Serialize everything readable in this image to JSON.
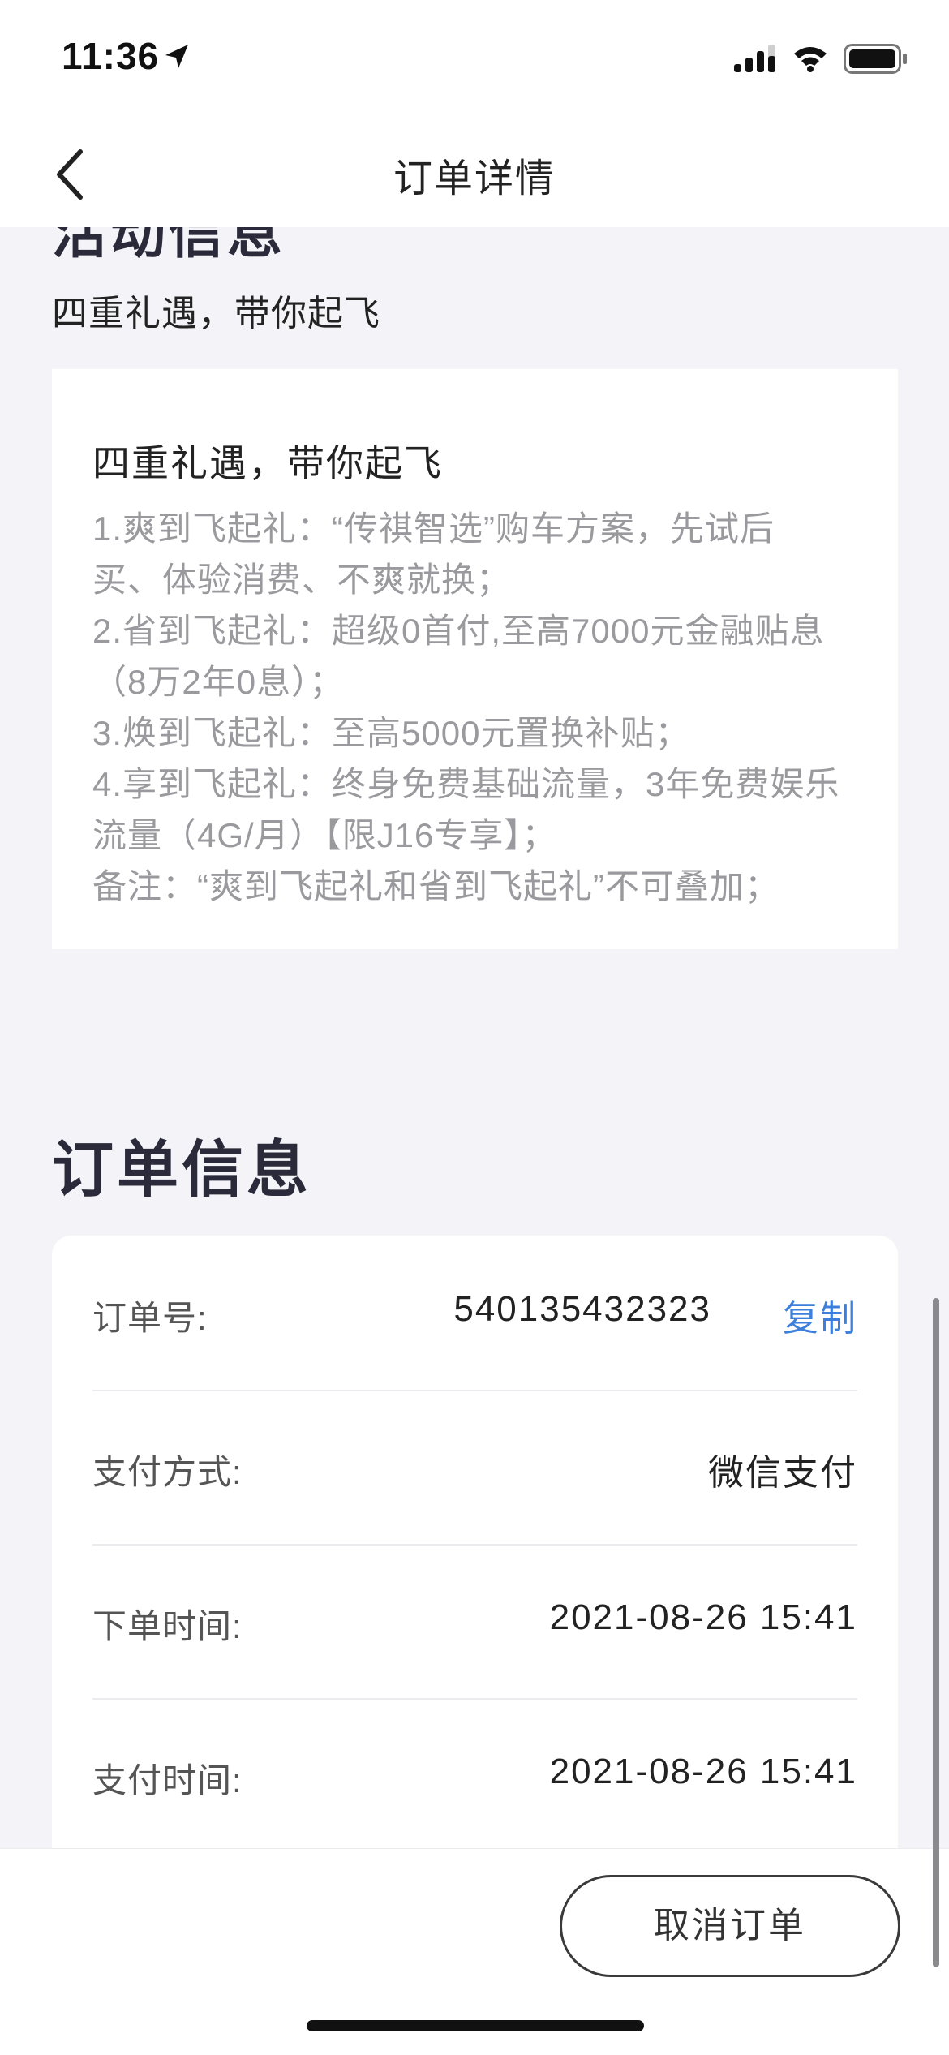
{
  "status_bar": {
    "time": "11:36",
    "icons": [
      "location-arrow-icon",
      "signal-icon",
      "wifi-icon",
      "battery-icon"
    ]
  },
  "nav": {
    "title": "订单详情",
    "back_icon": "chevron-left-icon"
  },
  "promo": {
    "cut_heading": "活动信息",
    "subtitle": "四重礼遇，带你起飞",
    "card_title": "四重礼遇，带你起飞",
    "lines": [
      "1.爽到飞起礼：“传祺智选”购车方案，先试后",
      "买、体验消费、不爽就换；",
      "2.省到飞起礼：超级0首付,至高7000元金融贴息",
      "（8万2年0息）；",
      "3.焕到飞起礼：至高5000元置换补贴；",
      "4.享到飞起礼：终身免费基础流量，3年免费娱乐",
      "流量（4G/月）【限J16专享】；",
      "备注：“爽到飞起礼和省到飞起礼”不可叠加；"
    ]
  },
  "order": {
    "heading": "订单信息",
    "rows": [
      {
        "label": "订单号:",
        "value": "540135432323",
        "action": "复制"
      },
      {
        "label": "支付方式:",
        "value": "微信支付"
      },
      {
        "label": "下单时间:",
        "value": "2021-08-26 15:41"
      },
      {
        "label": "支付时间:",
        "value": "2021-08-26 15:41"
      }
    ]
  },
  "bottom": {
    "cancel_label": "取消订单"
  },
  "colors": {
    "background": "#f4f4f8",
    "card": "#ffffff",
    "link": "#3d7fdc",
    "muted_text": "#9a9a9e"
  }
}
